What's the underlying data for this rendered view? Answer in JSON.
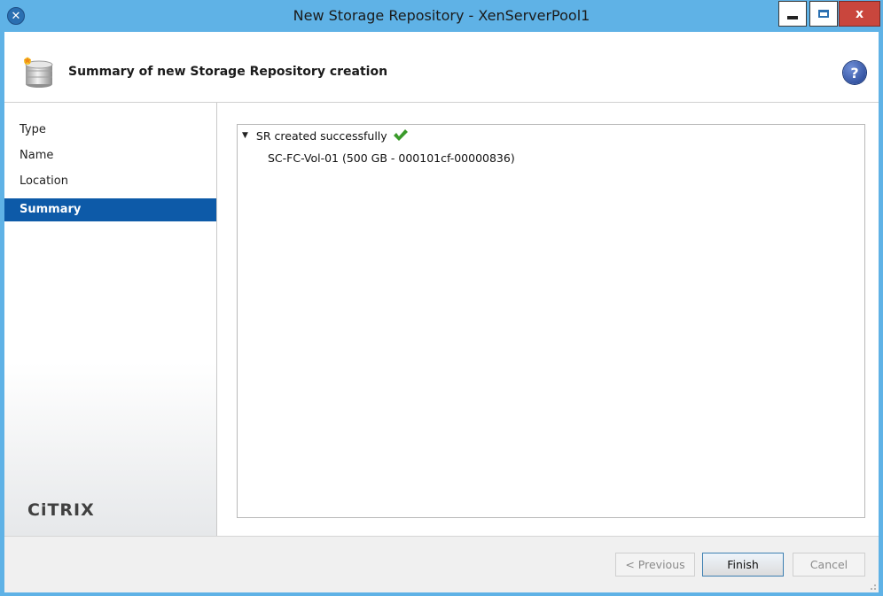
{
  "window": {
    "title": "New Storage Repository - XenServerPool1",
    "close_glyph": "x",
    "app_icon_glyph": "✕"
  },
  "header": {
    "title": "Summary of new Storage Repository creation",
    "icon": "storage-disk-icon",
    "help_glyph": "?"
  },
  "sidebar": {
    "items": [
      {
        "label": "Type",
        "active": false
      },
      {
        "label": "Name",
        "active": false
      },
      {
        "label": "Location",
        "active": false
      },
      {
        "label": "Summary",
        "active": true
      }
    ],
    "logo": "CiTRIX"
  },
  "summary": {
    "status": "SR created successfully",
    "detail": "SC-FC-Vol-01 (500 GB - 000101cf-00000836)"
  },
  "footer": {
    "previous_label": "< Previous",
    "finish_label": "Finish",
    "cancel_label": "Cancel"
  },
  "colors": {
    "titlebar": "#5fb2e6",
    "active_item": "#0d5aa8",
    "close_button": "#c9463d",
    "success_check": "#3a9a2a"
  }
}
